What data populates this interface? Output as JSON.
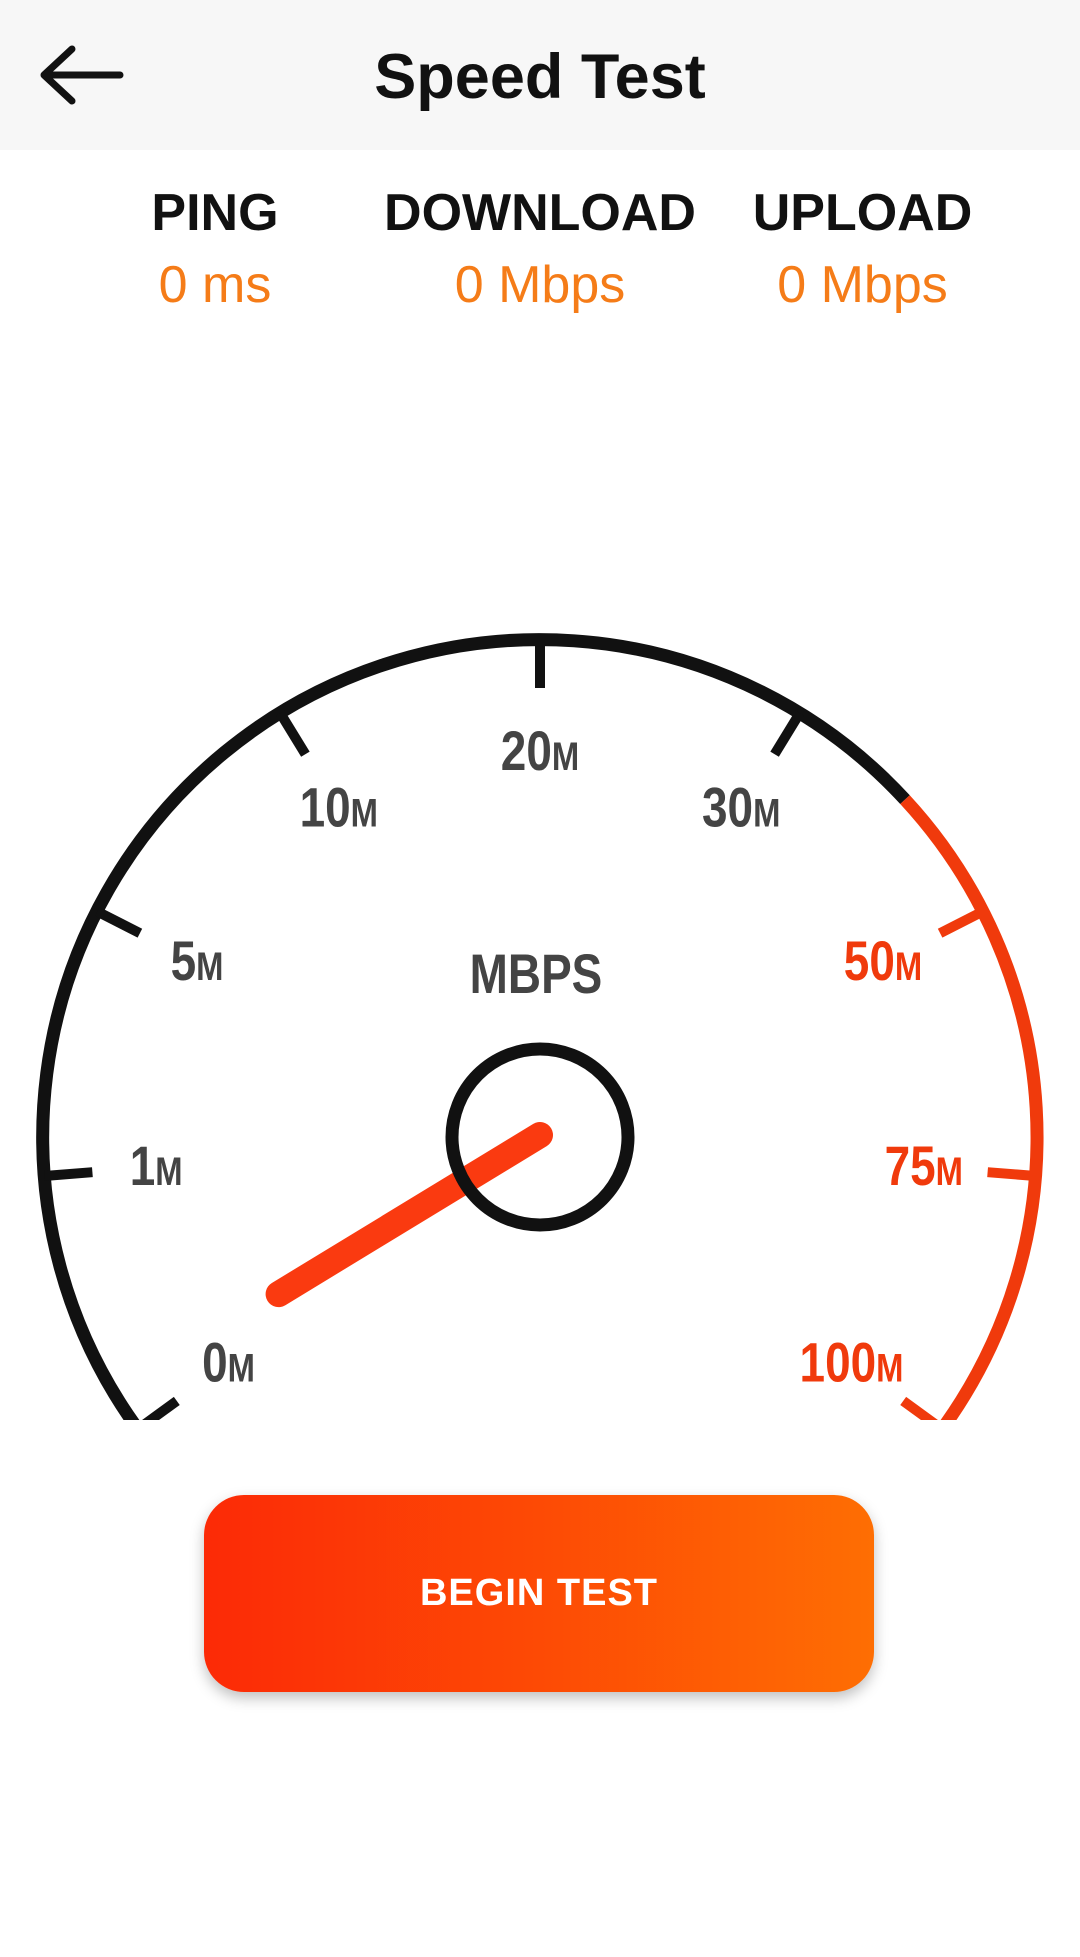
{
  "header": {
    "title": "Speed Test",
    "back_icon": "arrow-left-icon"
  },
  "stats": {
    "ping": {
      "label": "PING",
      "value": "0 ms"
    },
    "download": {
      "label": "DOWNLOAD",
      "value": "0 Mbps"
    },
    "upload": {
      "label": "UPLOAD",
      "value": "0 Mbps"
    }
  },
  "gauge": {
    "unit_label": "MBPS",
    "scale": [
      {
        "num": "0",
        "suffix": "M"
      },
      {
        "num": "1",
        "suffix": "M"
      },
      {
        "num": "5",
        "suffix": "M"
      },
      {
        "num": "10",
        "suffix": "M"
      },
      {
        "num": "20",
        "suffix": "M"
      },
      {
        "num": "30",
        "suffix": "M"
      },
      {
        "num": "50",
        "suffix": "M"
      },
      {
        "num": "75",
        "suffix": "M"
      },
      {
        "num": "100",
        "suffix": "M"
      }
    ],
    "current_value_mbps": 0,
    "colors": {
      "normal": "#111111",
      "high": "#f03a0c",
      "label": "#444444",
      "needle": "#fa3a10"
    }
  },
  "actions": {
    "begin_label": "BEGIN TEST"
  },
  "colors": {
    "accent": "#f57c18",
    "button_gradient_start": "#fc2a06",
    "button_gradient_end": "#fe6e03",
    "header_bg": "#f7f7f7"
  }
}
